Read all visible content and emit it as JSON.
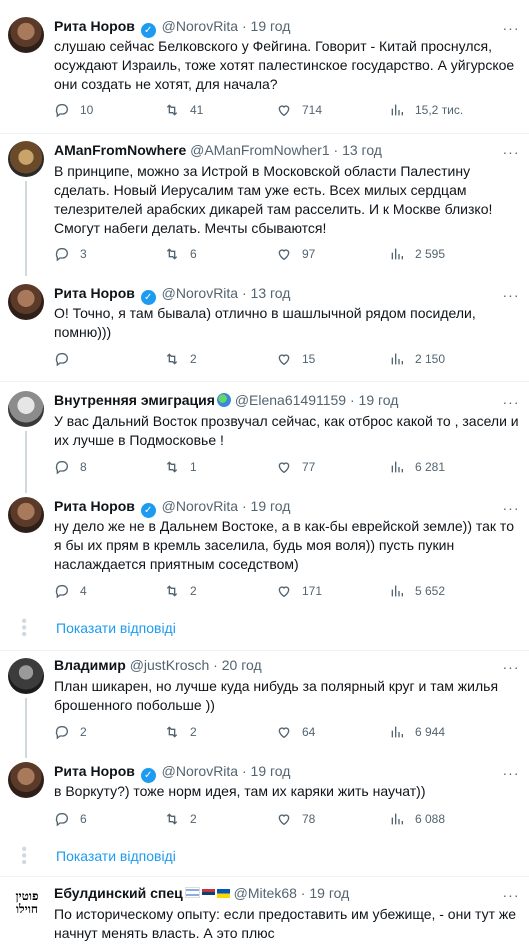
{
  "tweets": [
    {
      "name": "Рита Норов",
      "handle": "@NorovRita",
      "sep": "·",
      "time": "19 год",
      "text": "слушаю сейчас Белковского у Фейгина. Говорит - Китай проснулся, осуждают Израиль, тоже хотят палестинское государство. А уйгурское они создать не хотят, для начала?",
      "replies": "10",
      "retweets": "41",
      "likes": "714",
      "views": "15,2 тис."
    },
    {
      "name": "AManFromNowhere",
      "handle": "@AManFromNowher1",
      "sep": "·",
      "time": "13 год",
      "text": "В принципе, можно за Истрой в Московской области Палестину сделать. Новый Иерусалим там уже есть. Всех милых сердцам телезрителей арабских дикарей там расселить. И к Москве близко! Смогут набеги делать. Мечты сбываются!",
      "replies": "3",
      "retweets": "6",
      "likes": "97",
      "views": "2 595"
    },
    {
      "name": "Рита Норов",
      "handle": "@NorovRita",
      "sep": "·",
      "time": "13 год",
      "text": "О! Точно, я там бывала) отлично в шашлычной рядом посидели, помню)))",
      "replies": "",
      "retweets": "2",
      "likes": "15",
      "views": "2 150"
    },
    {
      "name": "Внутренняя эмиграция",
      "handle": "@Elena61491159",
      "sep": "·",
      "time": "19 год",
      "text": "У вас Дальний Восток прозвучал сейчас, как отброс какой то , засели и их лучше в Подмосковье !",
      "replies": "8",
      "retweets": "1",
      "likes": "77",
      "views": "6 281"
    },
    {
      "name": "Рита Норов",
      "handle": "@NorovRita",
      "sep": "·",
      "time": "19 год",
      "text": "ну дело же не в Дальнем Востоке, а в как-бы еврейской земле)) так то я бы их прям в кремль заселила, будь моя воля)) пусть пукин наслаждается приятным соседством)",
      "replies": "4",
      "retweets": "2",
      "likes": "171",
      "views": "5 652"
    },
    {
      "name": "Владимир",
      "handle": "@justKrosch",
      "sep": "·",
      "time": "20 год",
      "text": "План шикарен, но лучше куда нибудь за полярный круг и там жилья брошенного побольше ))",
      "replies": "2",
      "retweets": "2",
      "likes": "64",
      "views": "6 944"
    },
    {
      "name": "Рита Норов",
      "handle": "@NorovRita",
      "sep": "·",
      "time": "19 год",
      "text": "в Воркуту?) тоже норм идея, там их каряки жить научат))",
      "replies": "6",
      "retweets": "2",
      "likes": "78",
      "views": "6 088"
    },
    {
      "name": "Ебулдинский спец",
      "handle": "@Mitek68",
      "sep": "·",
      "time": "19 год",
      "text": "По историческому опыту: если предоставить им убежище, - они тут же начнут менять власть. А это плюс",
      "avatar_text": "פוטין חוילו"
    }
  ],
  "show_replies_label": "Показати відповіді",
  "colors": {
    "accent": "#1d9bf0",
    "muted": "#536471",
    "text": "#0f1419",
    "line": "#cfd9de"
  }
}
